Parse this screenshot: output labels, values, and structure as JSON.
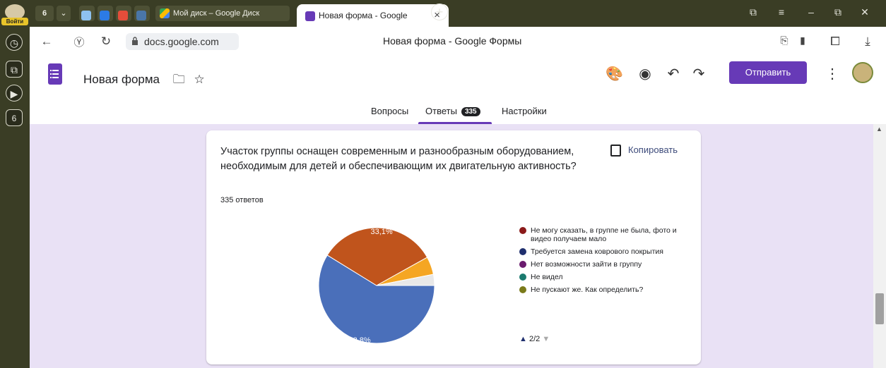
{
  "browser": {
    "login_label": "Войти",
    "tab_count_badge": "6",
    "tabs": [
      {
        "title": "Мой диск – Google Диск"
      },
      {
        "title": "Новая форма - Google"
      }
    ],
    "close_glyph": "×",
    "url": "docs.google.com",
    "page_title": "Новая форма - Google Формы",
    "sidebar_badge": "6"
  },
  "form": {
    "name": "Новая форма",
    "send_label": "Отправить",
    "tabs": {
      "questions": "Вопросы",
      "responses": "Ответы",
      "responses_count": "335",
      "settings": "Настройки"
    }
  },
  "card": {
    "question": "Участок группы оснащен современным и разнообразным оборудованием, необходимым для детей и обеспечивающим  их двигательную активность?",
    "response_count": "335 ответов",
    "copy_label": "Копировать",
    "pager": "2/2"
  },
  "chart_data": {
    "type": "pie",
    "slices": [
      {
        "label": "Требуется замена коврового покрытия",
        "value": 58.8,
        "color": "#4a6fba"
      },
      {
        "label": "",
        "value": 33.1,
        "color": "#c0541c"
      },
      {
        "label": "",
        "value": 5.0,
        "color": "#f5a623"
      },
      {
        "label": "",
        "value": 3.1,
        "color": "#e8e8e8"
      }
    ],
    "data_labels": [
      "58,8%",
      "33,1%"
    ],
    "legend": [
      {
        "label": "Не могу сказать, в группе не была, фото и видео получаем мало",
        "color": "#8b1a1a"
      },
      {
        "label": "Требуется замена коврового покрытия",
        "color": "#1f2f6e"
      },
      {
        "label": "Нет возможности зайти в группу",
        "color": "#6a1b6e"
      },
      {
        "label": "Не видел",
        "color": "#1a7a6e"
      },
      {
        "label": "Не пускают же. Как определить?",
        "color": "#7a7a1a"
      }
    ],
    "legend_position": "right"
  },
  "colors": {
    "accent": "#673ab7",
    "content_bg": "#e9e1f5"
  }
}
